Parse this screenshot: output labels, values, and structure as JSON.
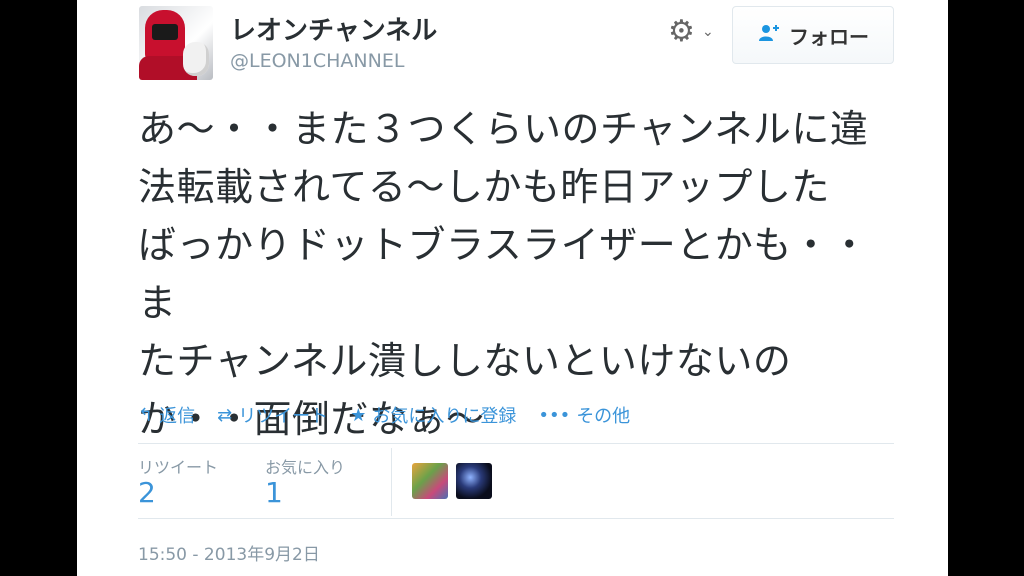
{
  "user": {
    "display_name": "レオンチャンネル",
    "handle": "@LEON1CHANNEL"
  },
  "follow_button": {
    "label": "フォロー"
  },
  "tweet": {
    "text_lines": [
      "あ〜・・また３つくらいのチャンネルに違",
      "法転載されてる〜しかも昨日アップした",
      "ばっかりドットブラスライザーとかも・・ま",
      "たチャンネル潰ししないといけないの",
      "か・・面倒だなぁ〜"
    ]
  },
  "actions": {
    "reply": "返信",
    "retweet": "リツイート",
    "favorite": "お気に入りに登録",
    "more": "その他"
  },
  "stats": {
    "retweets_label": "リツイート",
    "retweets_value": "2",
    "favorites_label": "お気に入り",
    "favorites_value": "1"
  },
  "timestamp": "15:50 - 2013年9月2日",
  "colors": {
    "accent": "#3b94d9",
    "text": "#292f33",
    "muted": "#8899a6",
    "background": "#ffffff",
    "letterbox": "#000000"
  },
  "icons": {
    "settings": "gear-icon",
    "follow": "add-person-icon",
    "reply": "reply-icon",
    "retweet": "retweet-icon",
    "favorite": "star-icon",
    "more": "more-dots-icon"
  }
}
